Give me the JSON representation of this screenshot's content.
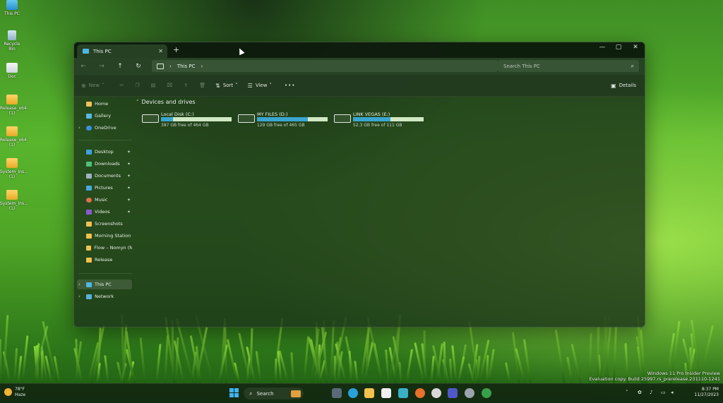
{
  "desktop": {
    "icons": [
      {
        "label": "This PC",
        "kind": "pc"
      },
      {
        "label": "Recycle Bin",
        "kind": "bin"
      },
      {
        "label": "Doc",
        "kind": "doc"
      },
      {
        "label": "Release_x64 (1)",
        "kind": "folder"
      },
      {
        "label": "Release_x64 (1)",
        "kind": "folder"
      },
      {
        "label": "System_Ins... (1)",
        "kind": "folder"
      },
      {
        "label": "System_Ins... (1)",
        "kind": "folder"
      }
    ]
  },
  "window": {
    "tab_title": "This PC",
    "tab_close": "✕",
    "new_tab": "+",
    "controls": {
      "minimize": "—",
      "maximize": "▢",
      "close": "✕"
    },
    "breadcrumb": {
      "item": "This PC",
      "sep1": "›",
      "sep2": "›"
    },
    "search_placeholder": "Search This PC",
    "commands": {
      "new": "New",
      "sort": "Sort",
      "view": "View",
      "more": "•••",
      "details": "Details"
    },
    "nav": {
      "home": "Home",
      "gallery": "Gallery",
      "onedrive": "OneDrive",
      "desktop": "Desktop",
      "downloads": "Downloads",
      "documents": "Documents",
      "pictures": "Pictures",
      "music": "Music",
      "videos": "Videos",
      "screenshots": "Screenshots",
      "morning": "Morning Station",
      "flow": "Flow – Nomyn (No",
      "release": "Release",
      "thispc": "This PC",
      "network": "Network"
    },
    "group_label": "Devices and drives",
    "drives": [
      {
        "name": "Local Disk (C:)",
        "free": "387 GB free of 464 GB",
        "used_fraction": 0.17
      },
      {
        "name": "MY FILES (D:)",
        "free": "129 GB free of 465 GB",
        "used_fraction": 0.72
      },
      {
        "name": "LINK VEGAS (E:)",
        "free": "52.3 GB free of 111 GB",
        "used_fraction": 0.53
      }
    ]
  },
  "taskbar": {
    "weather_temp": "78°F",
    "weather_desc": "Haze",
    "search_label": "Search",
    "time": "8:37 PM",
    "date": "11/27/2023"
  },
  "watermark": {
    "line1": "Windows 11 Pro Insider Preview",
    "line2": "Evaluation copy. Build 25997.rs_prerelease.231110-1241"
  },
  "colors": {
    "accent": "#3aa6cf",
    "window_bg": "#1c341a",
    "folder": "#f2c14e"
  }
}
